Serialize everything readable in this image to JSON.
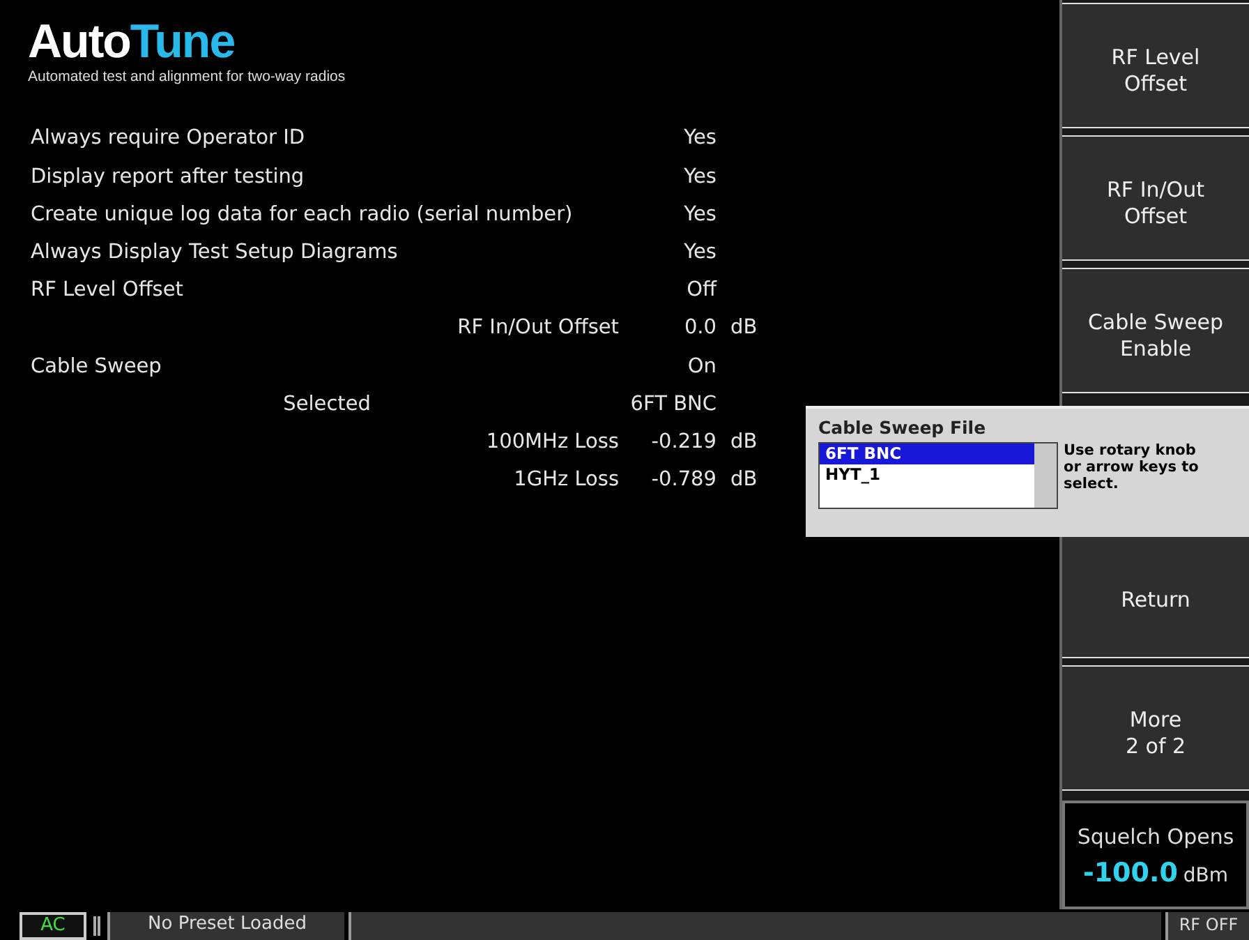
{
  "logo": {
    "parts": [
      {
        "text": "Auto",
        "color": "#ffffff"
      },
      {
        "text": "Tune",
        "color": "#29b8ea"
      }
    ],
    "tagline": "Automated test and alignment for two-way radios"
  },
  "settings": [
    {
      "kind": "main",
      "label": "Always require Operator ID",
      "value": "Yes"
    },
    {
      "kind": "main",
      "label": "Display report after testing",
      "value": "Yes"
    },
    {
      "kind": "main",
      "label": "Create unique log data for each radio (serial number)",
      "value": "Yes"
    },
    {
      "kind": "main",
      "label": "Always Display Test Setup Diagrams",
      "value": "Yes"
    },
    {
      "kind": "main",
      "label": "RF Level Offset",
      "value": "Off"
    },
    {
      "kind": "sub",
      "label": "RF In/Out Offset",
      "value": "0.0",
      "unit": "dB"
    },
    {
      "kind": "main",
      "label": "Cable Sweep",
      "value": "On"
    },
    {
      "kind": "mid",
      "label": "Selected",
      "value": "6FT BNC"
    },
    {
      "kind": "sub",
      "label": "100MHz Loss",
      "value": "-0.219",
      "unit": "dB"
    },
    {
      "kind": "sub",
      "label": "1GHz Loss",
      "value": "-0.789",
      "unit": "dB"
    }
  ],
  "softkeys": [
    {
      "lines": [
        "RF Level",
        "Offset"
      ]
    },
    {
      "lines": [
        "RF In/Out",
        "Offset"
      ]
    },
    {
      "lines": [
        "Cable Sweep",
        "Enable"
      ]
    },
    {
      "lines": [
        "Return"
      ]
    },
    {
      "lines": [
        "More",
        "2 of 2"
      ]
    }
  ],
  "squelch": {
    "label": "Squelch Opens",
    "value": "-100.0",
    "unit": "dBm"
  },
  "popup": {
    "title": "Cable Sweep File",
    "items": [
      {
        "text": "6FT BNC",
        "selected": true
      },
      {
        "text": "HYT_1",
        "selected": false
      }
    ],
    "hint": "Use rotary knob or arrow keys to select."
  },
  "status_bar": {
    "mode": "AC",
    "preset": "No Preset Loaded",
    "rf": "RF OFF"
  }
}
